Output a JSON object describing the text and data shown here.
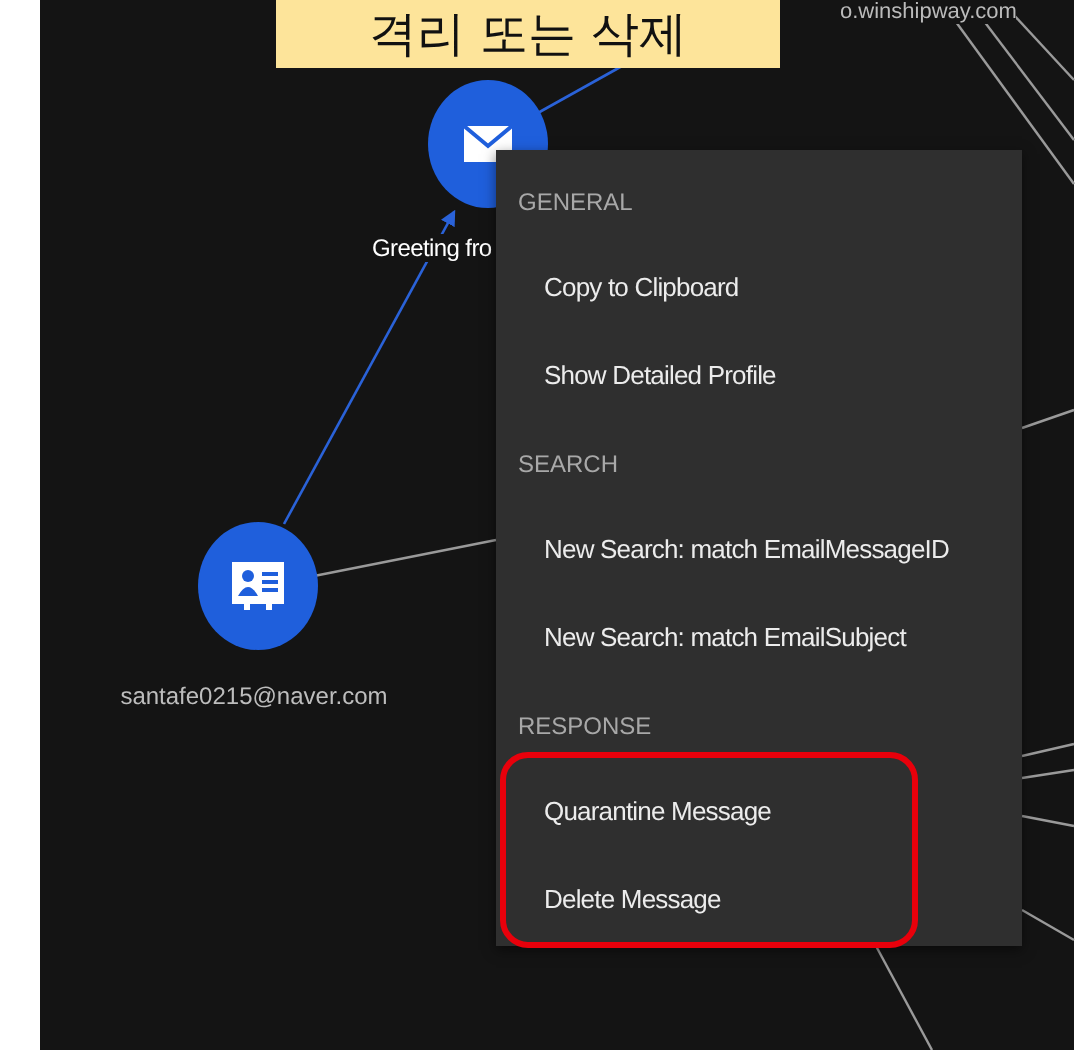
{
  "callout": {
    "text": "격리 또는 삭제"
  },
  "graph": {
    "nodes": [
      {
        "kind": "email",
        "label": "Greeting fro"
      },
      {
        "kind": "contact",
        "label": "santafe0215@naver.com"
      }
    ],
    "edge_labels": [
      "o.winshipway.com"
    ]
  },
  "context_menu": {
    "sections": [
      {
        "header": "GENERAL",
        "highlighted": false,
        "items": [
          {
            "label": "Copy to Clipboard"
          },
          {
            "label": "Show Detailed Profile"
          }
        ]
      },
      {
        "header": "SEARCH",
        "highlighted": false,
        "items": [
          {
            "label": "New Search: match EmailMessageID"
          },
          {
            "label": "New Search: match EmailSubject"
          }
        ]
      },
      {
        "header": "RESPONSE",
        "highlighted": true,
        "items": [
          {
            "label": "Quarantine Message"
          },
          {
            "label": "Delete Message"
          }
        ]
      }
    ]
  }
}
